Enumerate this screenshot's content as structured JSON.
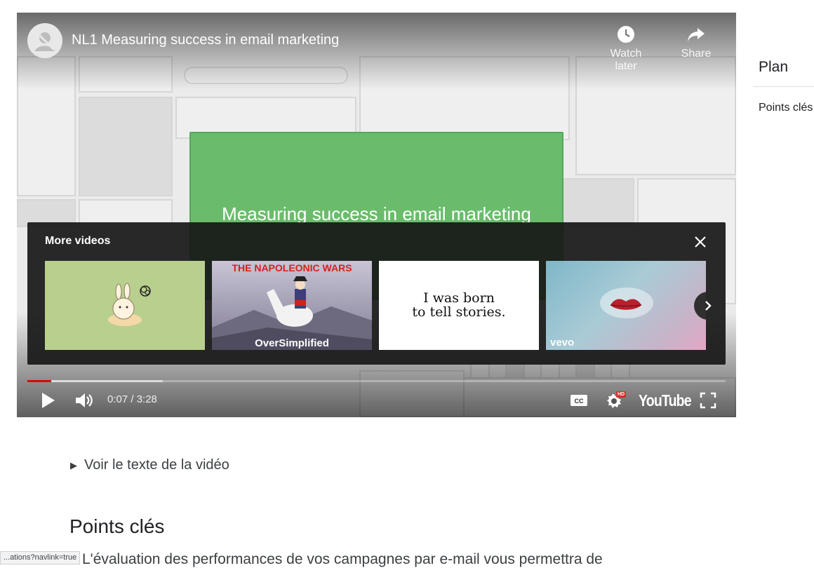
{
  "player": {
    "title": "NL1 Measuring success in email marketing",
    "slide_title": "Measuring success in email marketing",
    "watch_later_label": "Watch later",
    "share_label": "Share",
    "more_videos": {
      "label": "More videos",
      "thumbnails": [
        {
          "kind": "cartoon-rabbit"
        },
        {
          "caption_top": "THE NAPOLEONIC WARS",
          "caption_bottom": "OverSimplified"
        },
        {
          "text_line1": "I was born",
          "text_line2": "to tell stories."
        },
        {
          "badge": "vevo"
        }
      ]
    },
    "time_display": "0:07 / 3:28",
    "progress": {
      "played_fraction": 0.034,
      "loaded_fraction": 0.194
    },
    "hd_badge": "HD",
    "brand_label": "YouTube",
    "accent_red": "#e00000"
  },
  "sidebar": {
    "title": "Plan",
    "items": [
      "Points clés"
    ]
  },
  "article": {
    "transcript_toggle": "Voir le texte de la vidéo",
    "section_heading": "Points clés",
    "body_text": "L'évaluation des performances de vos campagnes par e-mail vous permettra de"
  },
  "status_bar": {
    "url": "...ations?navlink=true"
  }
}
